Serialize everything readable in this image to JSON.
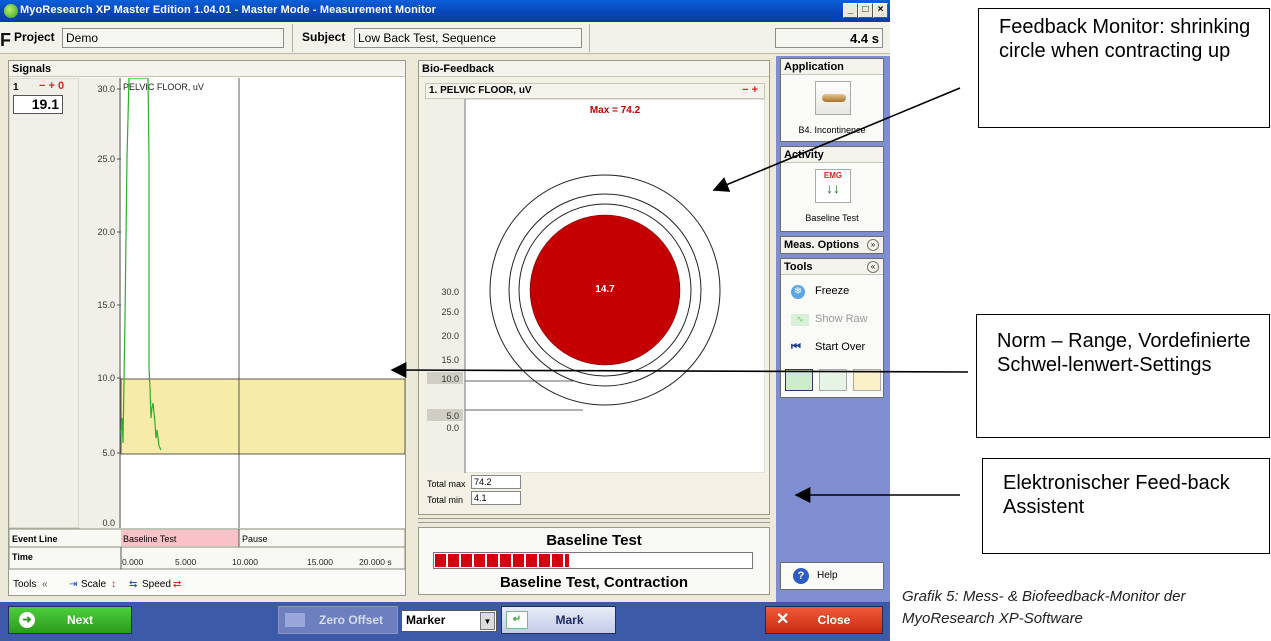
{
  "window": {
    "title": "MyoResearch XP Master Edition 1.04.01 - Master Mode - Measurement Monitor",
    "buttons": [
      "_",
      "×"
    ],
    "maximize": "□"
  },
  "header": {
    "project_label": "Project",
    "project_value": "Demo",
    "subject_label": "Subject",
    "subject_value": "Low Back Test, Sequence",
    "elapsed": "4.4 s"
  },
  "signals": {
    "title": "Signals",
    "channel_number": "1",
    "channel_controls": "− + 0",
    "current_value": "19.1",
    "channel_name": "PELVIC FLOOR, uV",
    "y_ticks": [
      "30.0",
      "25.0",
      "20.0",
      "15.0",
      "10.0",
      "5.0",
      "0.0"
    ],
    "event_line_label": "Event Line",
    "events": [
      "Baseline Test",
      "Pause"
    ],
    "time_label": "Time",
    "time_ticks": [
      "0.000",
      "5.000",
      "10.000",
      "15.000",
      "20.000 s"
    ],
    "tools_label": "Tools",
    "scale_label": "Scale",
    "speed_label": "Speed"
  },
  "biofeedback": {
    "title": "Bio-Feedback",
    "channel_name": "1. PELVIC FLOOR, uV",
    "channel_controls": "− +",
    "max_label": "Max = 74.2",
    "y_ticks": [
      "30.0",
      "25.0",
      "20.0",
      "15.0",
      "10.0",
      "5.0",
      "0.0"
    ],
    "threshold_values": [
      "10.0",
      "5.0"
    ],
    "circle_value": "14.7",
    "total_max_label": "Total max",
    "total_max_value": "74.2",
    "total_min_label": "Total min",
    "total_min_value": "4.1"
  },
  "status": {
    "title": "Baseline Test",
    "subtitle": "Baseline Test,  Contraction",
    "progress_fraction": 0.42
  },
  "sidebar": {
    "application_title": "Application",
    "application_name": "B4. Incontinence",
    "activity_title": "Activity",
    "activity_icon_text": "EMG",
    "activity_name": "Baseline Test",
    "meas_options": "Meas. Options",
    "tools_title": "Tools",
    "tools": [
      "Freeze",
      "Show Raw",
      "Start Over"
    ],
    "help": "Help"
  },
  "bottom": {
    "next": "Next",
    "zero_offset": "Zero Offset",
    "marker_select": "Marker",
    "mark": "Mark",
    "close": "Close"
  },
  "annotations": {
    "feedback_monitor": "Feedback Monitor: shrinking circle when contracting up",
    "norm_range": "Norm – Range, Vordefinierte Schwel-lenwert-Settings",
    "assistant": "Elektronischer Feed-back Assistent",
    "caption": "Grafik 5: Mess- & Biofeedback-Monitor der MyoResearch XP-Software"
  },
  "colors": {
    "accent_red": "#c40000",
    "signal_green": "#22b022",
    "norm_band": "#f5e8a8",
    "sidebar_blue": "#7e8ed0"
  }
}
